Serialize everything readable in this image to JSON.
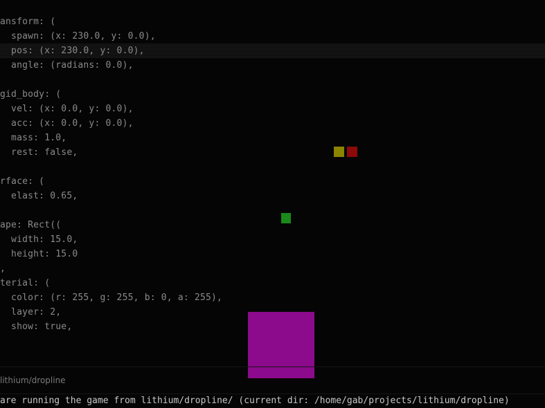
{
  "editor": {
    "lines": [
      "ansform: (",
      "  spawn: (x: 230.0, y: 0.0),",
      "  pos: (x: 230.0, y: 0.0),",
      "  angle: (radians: 0.0),",
      "",
      "gid_body: (",
      "  vel: (x: 0.0, y: 0.0),",
      "  acc: (x: 0.0, y: 0.0),",
      "  mass: 1.0,",
      "  rest: false,",
      "",
      "rface: (",
      "  elast: 0.65,",
      "",
      "ape: Rect((",
      "  width: 15.0,",
      "  height: 15.0",
      ",",
      "terial: (",
      "  color: (r: 255, g: 255, b: 0, a: 255),",
      "  layer: 2,",
      "  show: true,"
    ]
  },
  "game": {
    "objects": [
      {
        "name": "yellow-square",
        "color": "#8a8400"
      },
      {
        "name": "red-square",
        "color": "#8c0a0a"
      },
      {
        "name": "green-square",
        "color": "#1a8a1a"
      },
      {
        "name": "purple-square",
        "color": "#8c0a8c"
      }
    ]
  },
  "status": {
    "path": "lithium/dropline"
  },
  "message": {
    "text": "are running the game from lithium/dropline/ (current dir: /home/gab/projects/lithium/dropline)"
  }
}
